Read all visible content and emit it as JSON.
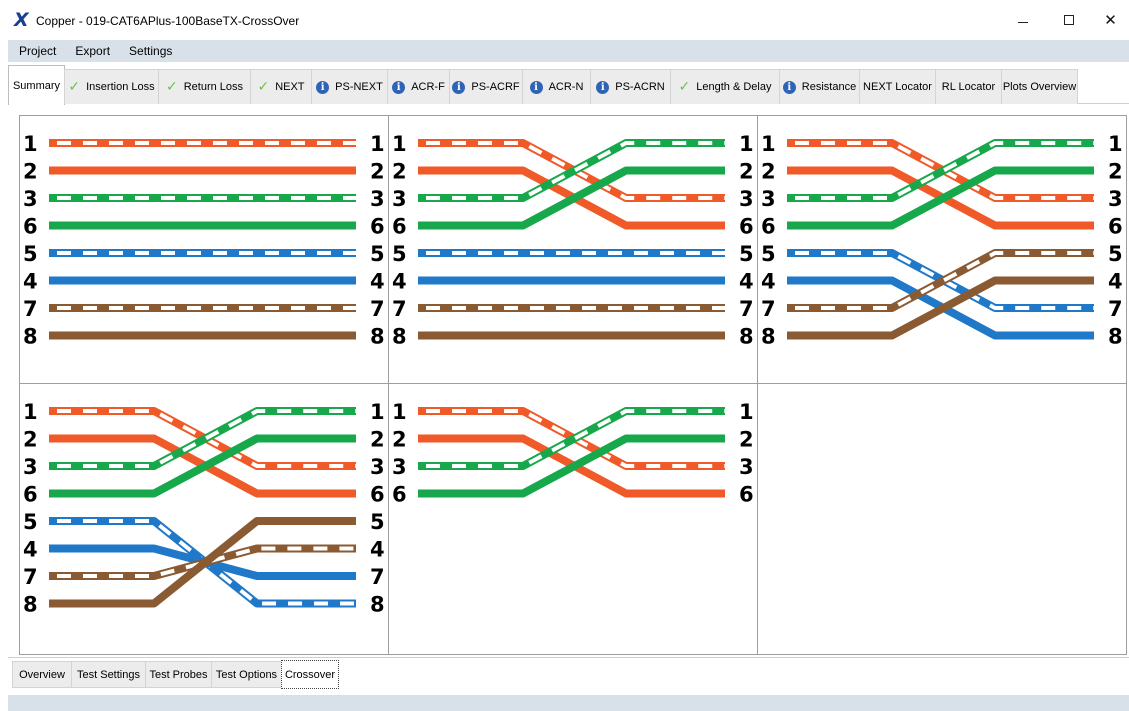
{
  "window": {
    "app_icon": "X",
    "title": "Copper - 019-CAT6APlus-100BaseTX-CrossOver",
    "minimize_glyph": "",
    "maximize_glyph": "",
    "close_glyph": "✕"
  },
  "menu": {
    "items": [
      "Project",
      "Export",
      "Settings"
    ]
  },
  "tabs": [
    {
      "label": "Summary",
      "icon": "",
      "active": true
    },
    {
      "label": "Insertion Loss",
      "icon": "check-icon"
    },
    {
      "label": "Return Loss",
      "icon": "check-icon"
    },
    {
      "label": "NEXT",
      "icon": "check-icon"
    },
    {
      "label": "PS-NEXT",
      "icon": "info-icon"
    },
    {
      "label": "ACR-F",
      "icon": "info-icon"
    },
    {
      "label": "PS-ACRF",
      "icon": "info-icon"
    },
    {
      "label": "ACR-N",
      "icon": "info-icon"
    },
    {
      "label": "PS-ACRN",
      "icon": "info-icon"
    },
    {
      "label": "Length & Delay",
      "icon": "check-icon"
    },
    {
      "label": "Resistance",
      "icon": "info-icon"
    },
    {
      "label": "NEXT Locator",
      "icon": ""
    },
    {
      "label": "RL Locator",
      "icon": ""
    },
    {
      "label": "Plots Overview",
      "icon": ""
    }
  ],
  "icons": {
    "check": "✓",
    "info": "i"
  },
  "wire_colors": {
    "orange": "#f05a28",
    "green": "#16a84a",
    "blue": "#1f78c8",
    "brown": "#8a5a33"
  },
  "diagrams": [
    {
      "name": "straight-through",
      "wires": [
        {
          "left_pin": "1",
          "right_pin": "1",
          "color": "orange",
          "striped": true
        },
        {
          "left_pin": "2",
          "right_pin": "2",
          "color": "orange",
          "striped": false
        },
        {
          "left_pin": "3",
          "right_pin": "3",
          "color": "green",
          "striped": true
        },
        {
          "left_pin": "6",
          "right_pin": "6",
          "color": "green",
          "striped": false
        },
        {
          "left_pin": "5",
          "right_pin": "5",
          "color": "blue",
          "striped": true
        },
        {
          "left_pin": "4",
          "right_pin": "4",
          "color": "blue",
          "striped": false
        },
        {
          "left_pin": "7",
          "right_pin": "7",
          "color": "brown",
          "striped": true
        },
        {
          "left_pin": "8",
          "right_pin": "8",
          "color": "brown",
          "striped": false
        }
      ],
      "routes": [
        0,
        1,
        2,
        3,
        4,
        5,
        6,
        7
      ]
    },
    {
      "name": "crossover-orange-green",
      "wires": [
        {
          "left_pin": "1",
          "right_pin": "1",
          "color": "orange",
          "striped": true
        },
        {
          "left_pin": "2",
          "right_pin": "2",
          "color": "orange",
          "striped": false
        },
        {
          "left_pin": "3",
          "right_pin": "3",
          "color": "green",
          "striped": true
        },
        {
          "left_pin": "6",
          "right_pin": "6",
          "color": "green",
          "striped": false
        },
        {
          "left_pin": "5",
          "right_pin": "5",
          "color": "blue",
          "striped": true
        },
        {
          "left_pin": "4",
          "right_pin": "4",
          "color": "blue",
          "striped": false
        },
        {
          "left_pin": "7",
          "right_pin": "7",
          "color": "brown",
          "striped": true
        },
        {
          "left_pin": "8",
          "right_pin": "8",
          "color": "brown",
          "striped": false
        }
      ],
      "routes": [
        2,
        3,
        0,
        1,
        4,
        5,
        6,
        7
      ]
    },
    {
      "name": "crossover-all-pairs",
      "wires": [
        {
          "left_pin": "1",
          "right_pin": "1",
          "color": "orange",
          "striped": true
        },
        {
          "left_pin": "2",
          "right_pin": "2",
          "color": "orange",
          "striped": false
        },
        {
          "left_pin": "3",
          "right_pin": "3",
          "color": "green",
          "striped": true
        },
        {
          "left_pin": "6",
          "right_pin": "6",
          "color": "green",
          "striped": false
        },
        {
          "left_pin": "5",
          "right_pin": "5",
          "color": "blue",
          "striped": true
        },
        {
          "left_pin": "4",
          "right_pin": "4",
          "color": "blue",
          "striped": false
        },
        {
          "left_pin": "7",
          "right_pin": "7",
          "color": "brown",
          "striped": true
        },
        {
          "left_pin": "8",
          "right_pin": "8",
          "color": "brown",
          "striped": false
        }
      ],
      "routes": [
        2,
        3,
        0,
        1,
        6,
        7,
        4,
        5
      ]
    },
    {
      "name": "crossover-all-pairs-twisted",
      "wires": [
        {
          "left_pin": "1",
          "right_pin": "1",
          "color": "orange",
          "striped": true
        },
        {
          "left_pin": "2",
          "right_pin": "2",
          "color": "orange",
          "striped": false
        },
        {
          "left_pin": "3",
          "right_pin": "3",
          "color": "green",
          "striped": true
        },
        {
          "left_pin": "6",
          "right_pin": "6",
          "color": "green",
          "striped": false
        },
        {
          "left_pin": "5",
          "right_pin": "5",
          "color": "blue",
          "striped": true
        },
        {
          "left_pin": "4",
          "right_pin": "4",
          "color": "blue",
          "striped": false
        },
        {
          "left_pin": "7",
          "right_pin": "7",
          "color": "brown",
          "striped": true
        },
        {
          "left_pin": "8",
          "right_pin": "8",
          "color": "brown",
          "striped": false
        }
      ],
      "routes": [
        2,
        3,
        0,
        1,
        7,
        6,
        5,
        4
      ]
    },
    {
      "name": "crossover-four-wire",
      "wires": [
        {
          "left_pin": "1",
          "right_pin": "1",
          "color": "orange",
          "striped": true
        },
        {
          "left_pin": "2",
          "right_pin": "2",
          "color": "orange",
          "striped": false
        },
        {
          "left_pin": "3",
          "right_pin": "3",
          "color": "green",
          "striped": true
        },
        {
          "left_pin": "6",
          "right_pin": "6",
          "color": "green",
          "striped": false
        }
      ],
      "routes": [
        2,
        3,
        0,
        1
      ]
    }
  ],
  "bottom_tabs": [
    {
      "label": "Overview"
    },
    {
      "label": "Test Settings"
    },
    {
      "label": "Test Probes"
    },
    {
      "label": "Test Options"
    },
    {
      "label": "Crossover",
      "active": true
    }
  ]
}
